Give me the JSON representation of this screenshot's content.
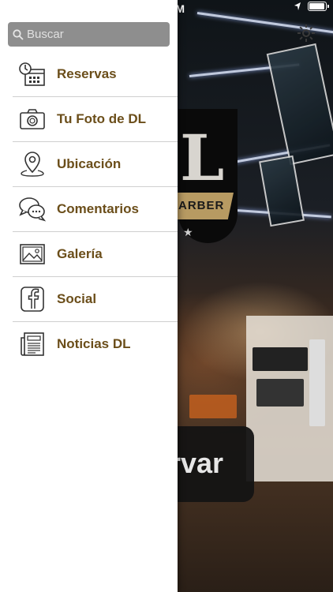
{
  "status_bar": {
    "time": "PM",
    "location_icon": "location-arrow-icon",
    "battery_icon": "battery-icon"
  },
  "colors": {
    "menu_text": "#6b4e1a",
    "search_bg": "#8e8e8e",
    "drawer_bg": "#ffffff",
    "logo_gold": "#b79a62"
  },
  "search": {
    "placeholder": "Buscar",
    "value": "",
    "icon": "search-icon"
  },
  "menu": {
    "items": [
      {
        "label": "Reservas",
        "icon": "calendar-clock-icon"
      },
      {
        "label": "Tu Foto de DL",
        "icon": "camera-icon"
      },
      {
        "label": "Ubicación",
        "icon": "map-pin-icon"
      },
      {
        "label": "Comentarios",
        "icon": "chat-bubbles-icon"
      },
      {
        "label": "Galería",
        "icon": "picture-icon"
      },
      {
        "label": "Social",
        "icon": "facebook-icon"
      },
      {
        "label": "Noticias DL",
        "icon": "newspaper-icon"
      }
    ]
  },
  "background": {
    "logo_letter": "L",
    "logo_ribbon": "ARBER",
    "logo_star": "★",
    "reserve_button_text": "rvar",
    "settings_icon": "gear-icon"
  }
}
